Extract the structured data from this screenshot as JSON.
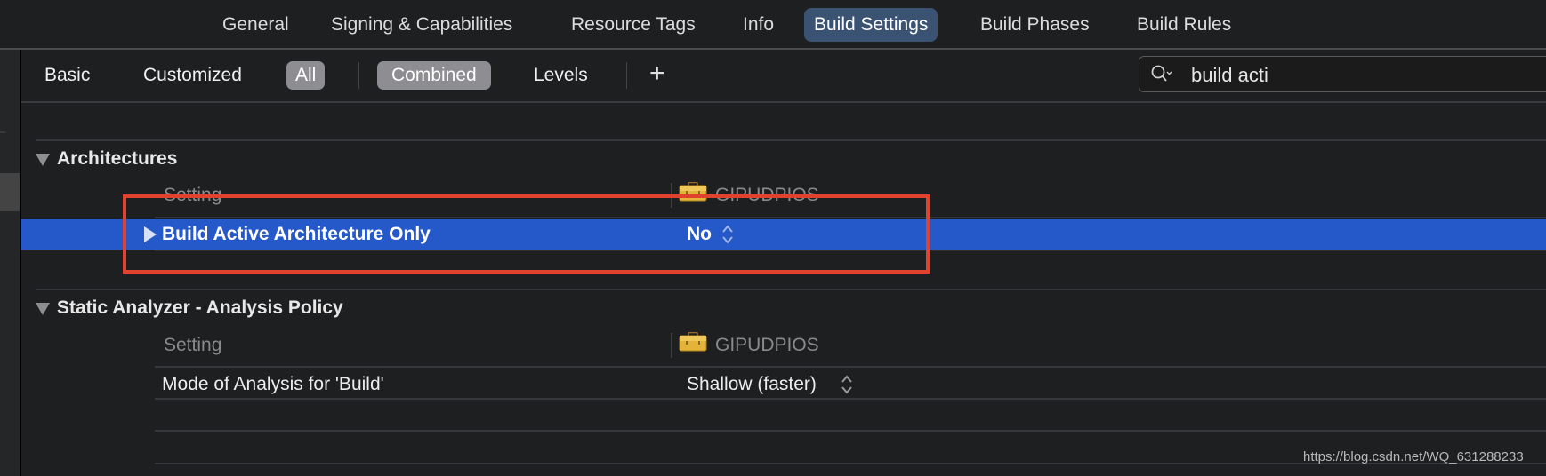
{
  "tabs": [
    {
      "label": "General",
      "active": false
    },
    {
      "label": "Signing & Capabilities",
      "active": false
    },
    {
      "label": "Resource Tags",
      "active": false
    },
    {
      "label": "Info",
      "active": false
    },
    {
      "label": "Build Settings",
      "active": true
    },
    {
      "label": "Build Phases",
      "active": false
    },
    {
      "label": "Build Rules",
      "active": false
    }
  ],
  "filters": {
    "basic": "Basic",
    "customized": "Customized",
    "all": "All",
    "combined": "Combined",
    "levels": "Levels",
    "add": "+"
  },
  "search": {
    "value": "build acti",
    "icon": "search-icon"
  },
  "sections": [
    {
      "title": "Architectures",
      "column_setting": "Setting",
      "column_target": "GIPUDPIOS",
      "target_icon": "toolbox-icon",
      "rows": [
        {
          "name": "Build Active Architecture Only",
          "value": "No",
          "selected": true
        }
      ]
    },
    {
      "title": "Static Analyzer - Analysis Policy",
      "column_setting": "Setting",
      "column_target": "GIPUDPIOS",
      "target_icon": "toolbox-icon",
      "rows": [
        {
          "name": "Mode of Analysis for 'Build'",
          "value": "Shallow (faster)",
          "selected": false
        }
      ]
    }
  ],
  "annotation": {
    "color": "#e0422e"
  },
  "colors": {
    "selection": "#2558c9",
    "active_tab": "#3b5373",
    "selected_filter": "#8d8d92"
  },
  "watermark": "https://blog.csdn.net/WQ_631288233"
}
